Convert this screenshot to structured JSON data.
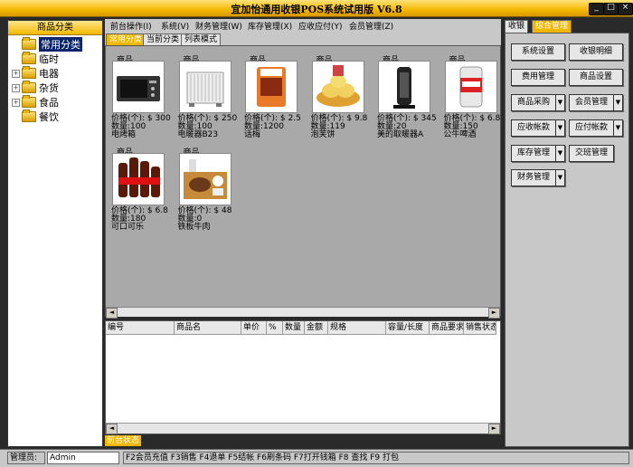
{
  "window": {
    "title": "宜加怡通用收银POS系统试用版 V6.8"
  },
  "left": {
    "header": "商品分类",
    "tree": [
      {
        "label": "常用分类",
        "expandable": false,
        "selected": true
      },
      {
        "label": "临时",
        "expandable": false,
        "selected": false
      },
      {
        "label": "电器",
        "expandable": true,
        "selected": false
      },
      {
        "label": "杂货",
        "expandable": true,
        "selected": false
      },
      {
        "label": "食品",
        "expandable": true,
        "selected": false
      },
      {
        "label": "餐饮",
        "expandable": false,
        "selected": false
      }
    ]
  },
  "menu": {
    "items": [
      "前台操作(I)",
      "系统(V)",
      "财务管理(W)",
      "库存管理(X)",
      "应收应付(Y)",
      "会员管理(Z)"
    ]
  },
  "tabs": {
    "items": [
      "常用分类",
      "当前分类",
      "列表模式"
    ],
    "active": 0
  },
  "products": [
    {
      "title": "商品",
      "price": "价格(个): $ 300",
      "qty": "数量:100",
      "name": "电烤箱",
      "pic": "oven"
    },
    {
      "title": "商品",
      "price": "价格(个): $ 250",
      "qty": "数量:100",
      "name": "电暖器B23",
      "pic": "heater"
    },
    {
      "title": "商品",
      "price": "价格(个): $ 2.5",
      "qty": "数量:1200",
      "name": "话梅",
      "pic": "snack"
    },
    {
      "title": "商品",
      "price": "价格(个): $ 9.8",
      "qty": "数量:119",
      "name": "泡芙饼",
      "pic": "cake"
    },
    {
      "title": "商品",
      "price": "价格(个): $ 345",
      "qty": "数量:20",
      "name": "美的取暖器A",
      "pic": "tower"
    },
    {
      "title": "商品",
      "price": "价格(个): $ 6.8",
      "qty": "数量:150",
      "name": "公牛啤酒",
      "pic": "can"
    },
    {
      "title": "商品",
      "price": "价格(个): $ 6.8",
      "qty": "数量:180",
      "name": "可口可乐",
      "pic": "cola"
    },
    {
      "title": "商品",
      "price": "价格(个): $ 48",
      "qty": "数量:0",
      "name": "铁板牛肉",
      "pic": "meal"
    }
  ],
  "table": {
    "columns": [
      "编号",
      "商品名",
      "单价",
      "%",
      "数量",
      "金额",
      "规格",
      "容量/长度",
      "商品要求",
      "销售状态"
    ]
  },
  "status_tab": "前台状态",
  "right": {
    "tabs": [
      "收银",
      "综合管理"
    ],
    "active_tab": 1,
    "buttons": {
      "sys_settings": "系统设置",
      "cash_detail": "收银明细",
      "expense_mgmt": "费用管理",
      "product_settings": "商品设置",
      "purchase": "商品采购",
      "member_mgmt": "会员管理",
      "receivable": "应收帐款",
      "payable": "应付帐款",
      "inventory": "库存管理",
      "shift_mgmt": "交班管理",
      "finance": "财务管理"
    }
  },
  "statusbar": {
    "label": "管理员:",
    "user": "Admin",
    "shortcuts": "F2会员充值 F3销售 F4退单 F5结帐 F6刷条码 F7打开钱箱 F8 查找 F9 打包"
  },
  "colors": {
    "accent": "#f1b700",
    "selection": "#0a246a"
  }
}
